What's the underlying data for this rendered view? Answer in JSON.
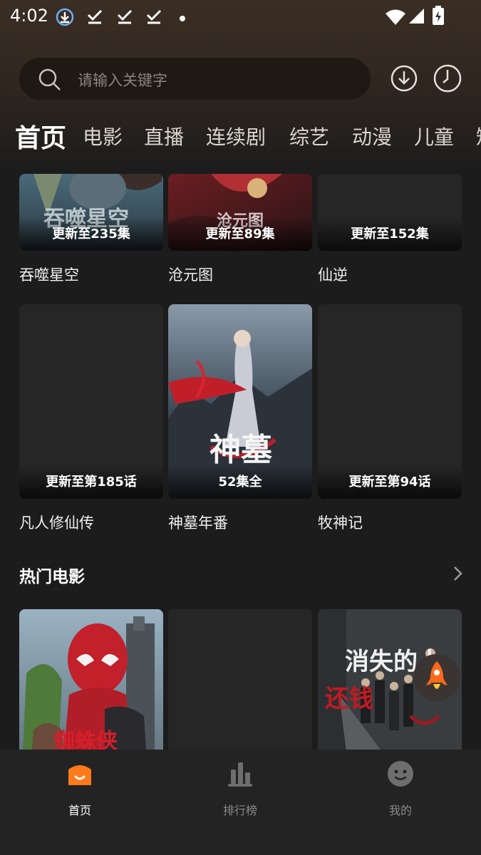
{
  "status_bar": {
    "time": "4:02"
  },
  "search": {
    "placeholder": "请输入关键字"
  },
  "tabs": [
    {
      "label": "首页",
      "active": true
    },
    {
      "label": "电影"
    },
    {
      "label": "直播"
    },
    {
      "label": "连续剧"
    },
    {
      "label": "综艺"
    },
    {
      "label": "动漫"
    },
    {
      "label": "儿童"
    },
    {
      "label": "短"
    }
  ],
  "anime_rows": [
    [
      {
        "title": "吞噬星空",
        "badge": "更新至235集",
        "poster_text": "吞噬星空"
      },
      {
        "title": "沧元图",
        "badge": "更新至89集",
        "poster_text": "沧元图"
      },
      {
        "title": "仙逆",
        "badge": "更新至152集"
      }
    ],
    [
      {
        "title": "凡人修仙传",
        "badge": "更新至第185话"
      },
      {
        "title": "神墓年番",
        "badge": "52集全",
        "poster_text": "神墓"
      },
      {
        "title": "牧神记",
        "badge": "更新至第94话"
      }
    ]
  ],
  "hot_movies": {
    "title": "热门电影",
    "items": [
      {
        "poster_text": "蜘蛛侠"
      },
      {
        "poster_text": ""
      },
      {
        "poster_text": "还钱",
        "poster_subtitle": "消失的人"
      }
    ]
  },
  "bottom_nav": [
    {
      "label": "首页",
      "icon": "home-icon",
      "active": true
    },
    {
      "label": "排行榜",
      "icon": "ranking-icon"
    },
    {
      "label": "我的",
      "icon": "profile-icon"
    }
  ],
  "colors": {
    "accent": "#ff7a1a",
    "background": "#1c1c1c",
    "nav_bg": "#232323"
  }
}
